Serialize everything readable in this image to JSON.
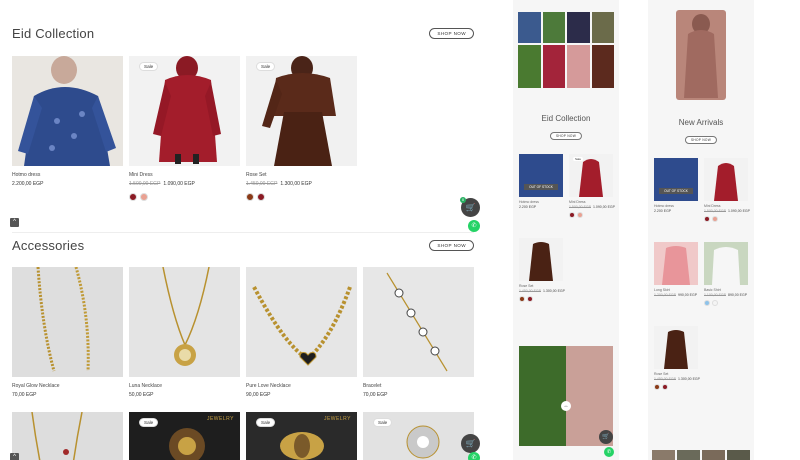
{
  "desktop": {
    "eid": {
      "title": "Eid Collection",
      "shop_now": "SHOP NOW",
      "products": [
        {
          "name": "Hotmo dress",
          "price": "2.200,00 EGP",
          "old_price": "",
          "sale": "",
          "swatches": []
        },
        {
          "name": "Mini Dress",
          "price": "1.090,00 EGP",
          "old_price": "1.500,00 EGP",
          "sale": "Sale",
          "swatches": [
            "#8b1a24",
            "#e9a192"
          ]
        },
        {
          "name": "Rose Set",
          "price": "1.300,00 EGP",
          "old_price": "1.450,00 EGP",
          "sale": "Sale",
          "swatches": [
            "#8a3a17",
            "#8b1a24"
          ]
        }
      ]
    },
    "accessories": {
      "title": "Accessories",
      "shop_now": "SHOP NOW",
      "products": [
        {
          "name": "Royal Glow Necklace",
          "price": "70,00 EGP"
        },
        {
          "name": "Luna Necklace",
          "price": "50,00 EGP"
        },
        {
          "name": "Pure Love Necklace",
          "price": "90,00 EGP"
        },
        {
          "name": "Bracelet",
          "price": "70,00 EGP"
        }
      ],
      "row2": [
        {
          "sale": ""
        },
        {
          "sale": "Sale",
          "brand": "JEWELRY"
        },
        {
          "sale": "Sale",
          "brand": "JEWELRY"
        },
        {
          "sale": "Sale"
        }
      ]
    },
    "icons": {
      "scroll_top": "^",
      "cart": "cart-icon",
      "whatsapp": "whatsapp-icon"
    },
    "cart_count": "0"
  },
  "mobile_a": {
    "title": "Eid Collection",
    "shop_now": "SHOP NOW",
    "out_of_stock": "OUT OF STOCK",
    "products": [
      {
        "name": "Hotmo dress",
        "price": "2.200 EGP",
        "old_price": ""
      },
      {
        "name": "Mini Dress",
        "price": "1.090,00 EGP",
        "old_price": "1.500,00 EGP",
        "sale": "Sale"
      },
      {
        "name": "Rose Set",
        "price": "1.300,00 EGP",
        "old_price": "1.450,00 EGP"
      }
    ]
  },
  "mobile_b": {
    "title": "New Arrivals",
    "shop_now": "SHOP NOW",
    "out_of_stock": "OUT OF STOCK",
    "products": [
      {
        "name": "Hotmo dress",
        "price": "2.200 EGP",
        "old_price": ""
      },
      {
        "name": "Mini Dress",
        "price": "1.090,00 EGP",
        "old_price": "1.500,00 EGP"
      },
      {
        "name": "Long Skirt",
        "price": "990,00 EGP",
        "old_price": "1.200,00 EGP"
      },
      {
        "name": "Basic Shirt",
        "price": "890,00 EGP",
        "old_price": "1.100,00 EGP"
      },
      {
        "name": "Rose Set",
        "price": "1.300,00 EGP",
        "old_price": "1.450,00 EGP"
      }
    ]
  },
  "colors": {
    "accent": "#444444",
    "whatsapp": "#25d366",
    "cart_badge": "#27ae60",
    "sale_text": "#999999"
  }
}
